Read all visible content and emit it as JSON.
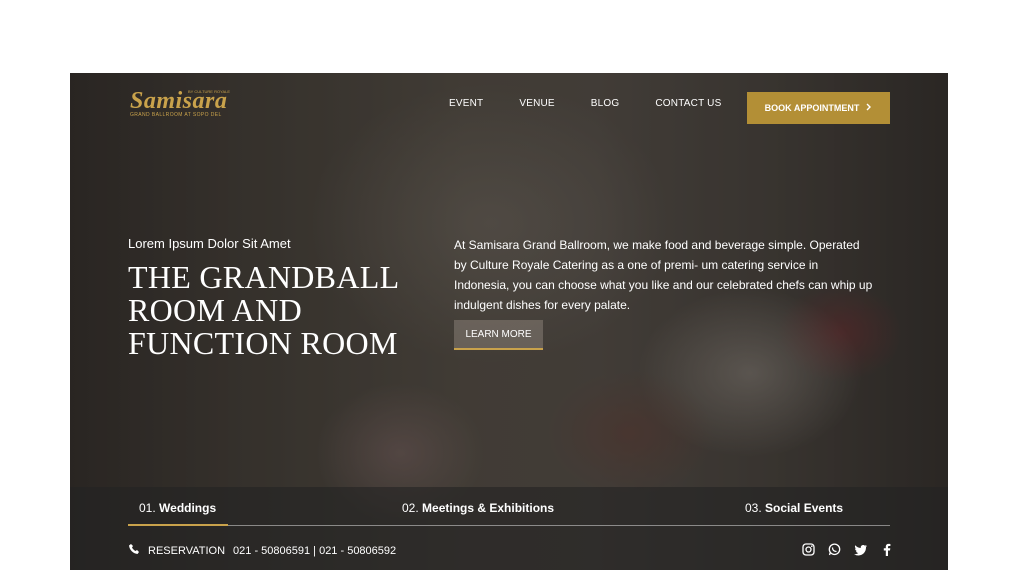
{
  "brand": {
    "name": "Samisara",
    "top_note": "BY CULTURE ROYALE",
    "subtitle": "GRAND BALLROOM AT SOPO DEL",
    "accent": "#c9a24b"
  },
  "nav": {
    "items": [
      "EVENT",
      "VENUE",
      "BLOG",
      "CONTACT US"
    ],
    "book_label": "BOOK APPOINTMENT",
    "book_icon": "chevron-right-icon",
    "book_color": "#b38f36"
  },
  "hero": {
    "tagline": "Lorem Ipsum Dolor Sit Amet",
    "title": "THE GRANDBALL ROOM AND FUNCTION ROOM",
    "description": "At Samisara Grand Ballroom, we make food and beverage simple. Operated by Culture Royale Catering as a one of premi- um catering service in Indonesia, you can choose what you like and our celebrated chefs can whip up indulgent dishes for every palate.",
    "learn_more": "LEARN MORE"
  },
  "tabs": [
    {
      "num": "01.",
      "label": "Weddings"
    },
    {
      "num": "02.",
      "label": "Meetings & Exhibitions"
    },
    {
      "num": "03.",
      "label": "Social Events"
    }
  ],
  "contact": {
    "icon": "phone-icon",
    "label": "RESERVATION",
    "phones": "021 - 50806591 | 021 - 50806592"
  },
  "social_icons": [
    "instagram-icon",
    "whatsapp-icon",
    "twitter-icon",
    "facebook-icon"
  ]
}
